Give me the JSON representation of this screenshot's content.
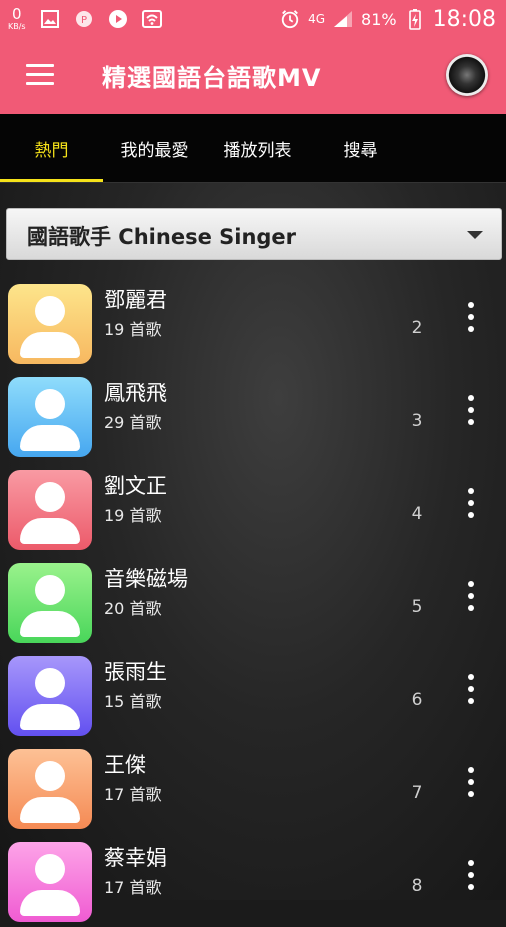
{
  "status_bar": {
    "network_speed": "0",
    "network_unit": "KB/s",
    "network_type": "4G",
    "battery": "81%",
    "time": "18:08"
  },
  "app_bar": {
    "title": "精選國語台語歌MV"
  },
  "tabs": [
    {
      "label": "熱門",
      "active": true
    },
    {
      "label": "我的最愛",
      "active": false
    },
    {
      "label": "播放列表",
      "active": false
    },
    {
      "label": "搜尋",
      "active": false
    }
  ],
  "dropdown": {
    "selected": "國語歌手 Chinese Singer"
  },
  "singers": [
    {
      "name": "鄧麗君",
      "songs": "19 首歌",
      "rank": "2",
      "color_top": "#fde58b",
      "color_bottom": "#f7b860"
    },
    {
      "name": "鳳飛飛",
      "songs": "29 首歌",
      "rank": "3",
      "color_top": "#8fdcfb",
      "color_bottom": "#46a7f0"
    },
    {
      "name": "劉文正",
      "songs": "19 首歌",
      "rank": "4",
      "color_top": "#f99aa3",
      "color_bottom": "#ec5a6a"
    },
    {
      "name": "音樂磁場",
      "songs": "20 首歌",
      "rank": "5",
      "color_top": "#9af28c",
      "color_bottom": "#49d65a"
    },
    {
      "name": "張雨生",
      "songs": "15 首歌",
      "rank": "6",
      "color_top": "#a797fb",
      "color_bottom": "#6250f0"
    },
    {
      "name": "王傑",
      "songs": "17 首歌",
      "rank": "7",
      "color_top": "#fdc195",
      "color_bottom": "#f58a54"
    },
    {
      "name": "蔡幸娟",
      "songs": "17 首歌",
      "rank": "8",
      "color_top": "#fda4e8",
      "color_bottom": "#f05bd2"
    }
  ]
}
